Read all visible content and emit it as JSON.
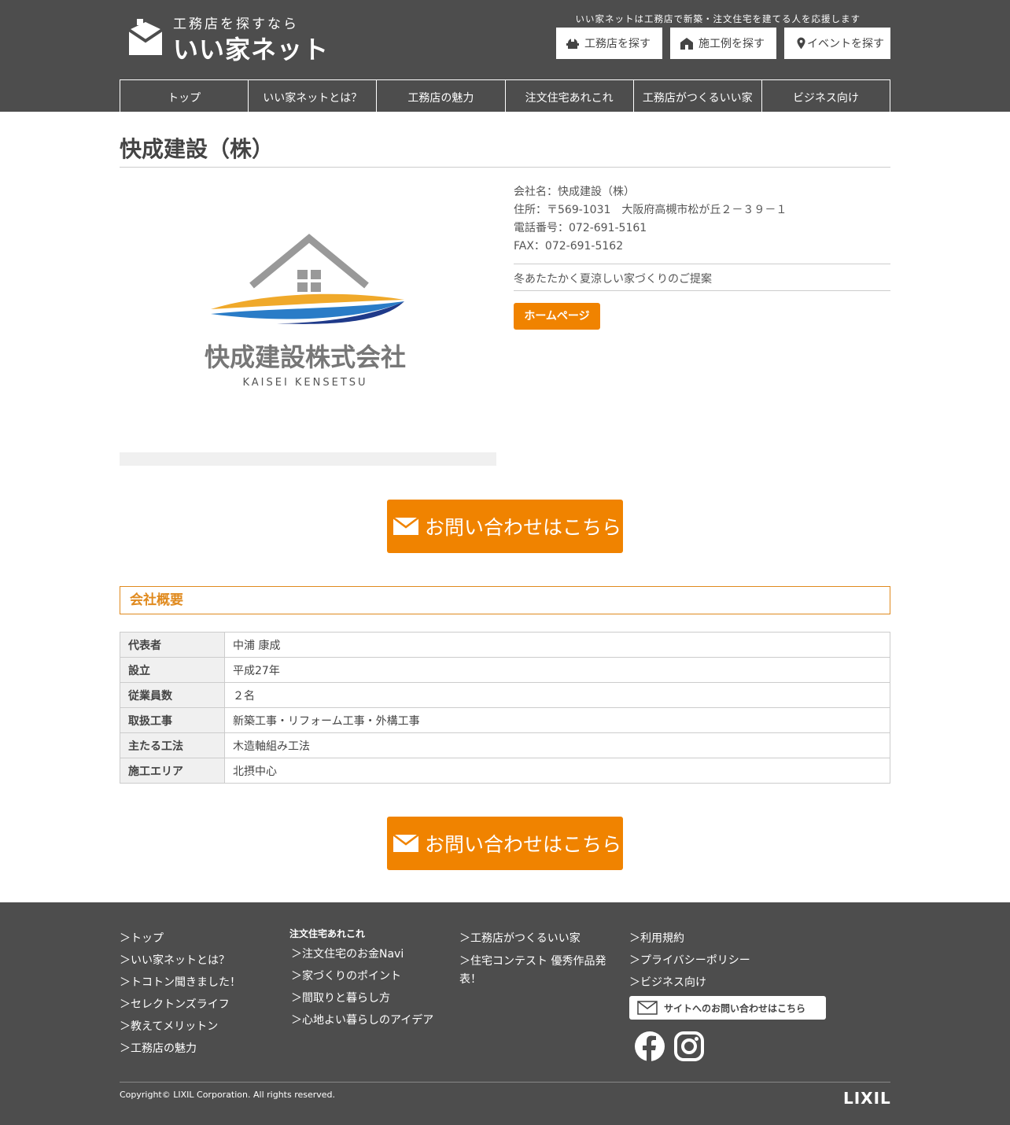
{
  "header": {
    "logo_sub": "工務店を探すなら",
    "logo_main": "いい家ネット",
    "tagline": "いい家ネットは工務店で新築・注文住宅を建てる人を応援します",
    "search_buttons": [
      {
        "label": "工務店を探す",
        "icon": "builder-icon"
      },
      {
        "label": "施工例を探す",
        "icon": "house-icon"
      },
      {
        "label": "イベントを探す",
        "icon": "map-pin-icon"
      }
    ],
    "nav": [
      "トップ",
      "いい家ネットとは？",
      "工務店の魅力",
      "注文住宅あれこれ",
      "工務店がつくるいい家",
      "ビジネス向け"
    ]
  },
  "company": {
    "title": "快成建設（株）",
    "logo_name": "快成建設株式会社",
    "logo_romaji": "KAISEI KENSETSU",
    "name_line": "会社名：快成建設（株）",
    "address_line": "住所：〒569-1031　大阪府高槻市松が丘２－３９－１",
    "tel_line": "電話番号：072-691-5161",
    "fax_line": "FAX：072-691-5162",
    "catch": "冬あたたかく夏涼しい家づくりのご提案",
    "homepage_label": "ホームページ"
  },
  "contact_label": "お問い合わせはこちら",
  "overview": {
    "title": "会社概要",
    "rows": [
      {
        "k": "代表者",
        "v": "中浦 康成"
      },
      {
        "k": "設立",
        "v": "平成27年"
      },
      {
        "k": "従業員数",
        "v": "２名"
      },
      {
        "k": "取扱工事",
        "v": "新築工事・リフォーム工事・外構工事"
      },
      {
        "k": "主たる工法",
        "v": "木造軸組み工法"
      },
      {
        "k": "施工エリア",
        "v": "北摂中心"
      }
    ]
  },
  "footer": {
    "col1": [
      "＞トップ",
      "＞いい家ネットとは？",
      "＞トコトン聞きました！",
      "＞セレクトンズライフ",
      "＞教えてメリットン",
      "＞工務店の魅力"
    ],
    "col2_heading": "注文住宅あれこれ",
    "col2": [
      "＞注文住宅のお金Navi",
      "＞家づくりのポイント",
      "＞間取りと暮らし方",
      "＞心地よい暮らしのアイデア"
    ],
    "col3": [
      "＞工務店がつくるいい家",
      "＞住宅コンテスト 優秀作品発",
      "表！"
    ],
    "col4": [
      "＞利用規約",
      "＞プライバシーポリシー",
      "＞ビジネス向け"
    ],
    "site_contact": "サイトへのお問い合わせはこちら",
    "copyright": "Copyright© LIXIL Corporation. All rights reserved.",
    "brand": "LIXIL"
  },
  "colors": {
    "header_bg": "#4d4d4d",
    "accent": "#f08300",
    "section_border": "#e08a1e"
  }
}
